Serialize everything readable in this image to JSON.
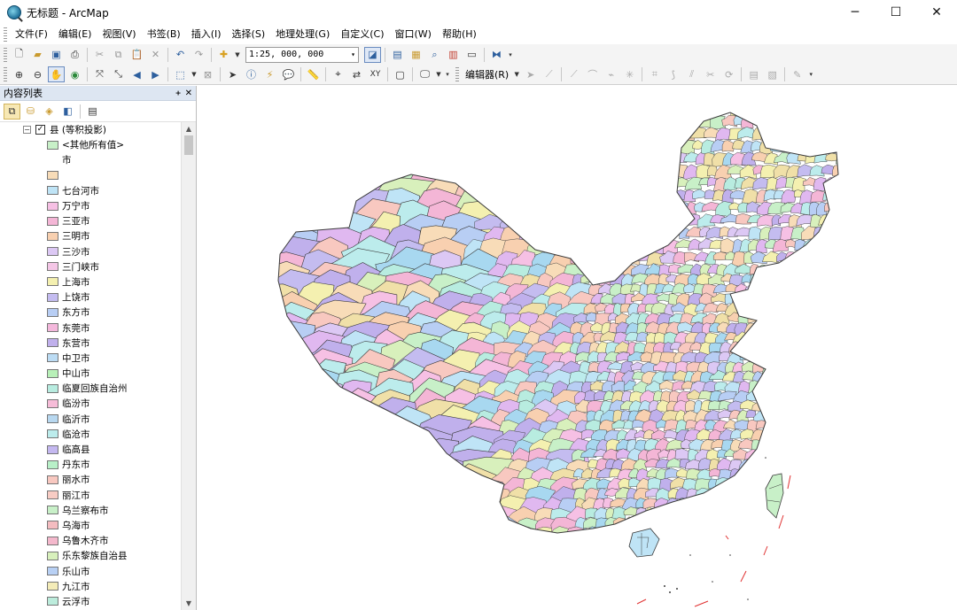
{
  "window": {
    "title": "无标题 - ArcMap",
    "minimize": "─",
    "maximize": "☐",
    "close": "✕"
  },
  "menu": [
    {
      "label": "文件(F)"
    },
    {
      "label": "编辑(E)"
    },
    {
      "label": "视图(V)"
    },
    {
      "label": "书签(B)"
    },
    {
      "label": "插入(I)"
    },
    {
      "label": "选择(S)"
    },
    {
      "label": "地理处理(G)"
    },
    {
      "label": "自定义(C)"
    },
    {
      "label": "窗口(W)"
    },
    {
      "label": "帮助(H)"
    }
  ],
  "toolbar": {
    "scale_value": "1:25, 000, 000",
    "editor_label": "编辑器(R)"
  },
  "toc": {
    "title": "内容列表",
    "pin": "ᚐ",
    "close": "✕",
    "layer_name": "县 (等积投影)",
    "items": [
      {
        "label": "<其他所有值>",
        "color": "#c8f0c8"
      },
      {
        "label": "市",
        "color": ""
      },
      {
        "label": "",
        "color": "#f8dcb8"
      },
      {
        "label": "七台河市",
        "color": "#bfe4f6"
      },
      {
        "label": "万宁市",
        "color": "#f6c0e4"
      },
      {
        "label": "三亚市",
        "color": "#f4b6d6"
      },
      {
        "label": "三明市",
        "color": "#f8d0b0"
      },
      {
        "label": "三沙市",
        "color": "#dcc8f4"
      },
      {
        "label": "三门峡市",
        "color": "#f4c6e6"
      },
      {
        "label": "上海市",
        "color": "#f4f0b0"
      },
      {
        "label": "上饶市",
        "color": "#c4bcf0"
      },
      {
        "label": "东方市",
        "color": "#b8cef4"
      },
      {
        "label": "东莞市",
        "color": "#f4b8dc"
      },
      {
        "label": "东营市",
        "color": "#c0b0ec"
      },
      {
        "label": "中卫市",
        "color": "#bcdcf4"
      },
      {
        "label": "中山市",
        "color": "#b8f0b8"
      },
      {
        "label": "临夏回族自治州",
        "color": "#b8ece0"
      },
      {
        "label": "临汾市",
        "color": "#f6bcd8"
      },
      {
        "label": "临沂市",
        "color": "#b8d8f0"
      },
      {
        "label": "临沧市",
        "color": "#bcecec"
      },
      {
        "label": "临高县",
        "color": "#c4b8f0"
      },
      {
        "label": "丹东市",
        "color": "#b8f0c8"
      },
      {
        "label": "丽水市",
        "color": "#f8c8c0"
      },
      {
        "label": "丽江市",
        "color": "#f8ccc4"
      },
      {
        "label": "乌兰察布市",
        "color": "#c8f0c8"
      },
      {
        "label": "乌海市",
        "color": "#f4bcc0"
      },
      {
        "label": "乌鲁木齐市",
        "color": "#f4b8cc"
      },
      {
        "label": "乐东黎族自治县",
        "color": "#d8f0bc"
      },
      {
        "label": "乐山市",
        "color": "#b8d0f4"
      },
      {
        "label": "九江市",
        "color": "#f4ecb8"
      },
      {
        "label": "云浮市",
        "color": "#bcecdc"
      }
    ]
  },
  "colors": {
    "map_border": "#3a3a3a",
    "palette": [
      "#c8f0c8",
      "#f8dcb8",
      "#bfe4f6",
      "#f6c0e4",
      "#f4b6d6",
      "#f8d0b0",
      "#dcc8f4",
      "#f4f0b0",
      "#c4bcf0",
      "#b8cef4",
      "#c0b0ec",
      "#b8ece0",
      "#bcecec",
      "#f8c8c0",
      "#d8f0bc",
      "#e0b8f0",
      "#f0e0a8",
      "#a8d8f0"
    ]
  }
}
